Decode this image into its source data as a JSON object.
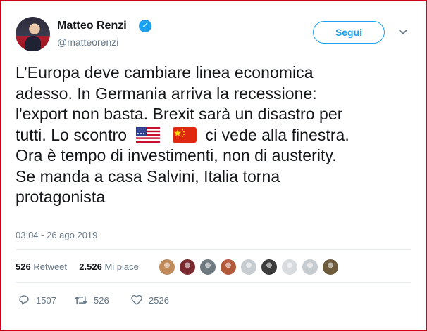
{
  "author": {
    "name": "Matteo Renzi",
    "handle": "@matteorenzi",
    "verified_icon": "verified-badge-icon"
  },
  "header": {
    "follow_label": "Segui",
    "menu_icon": "chevron-down-icon"
  },
  "tweet": {
    "line1": "L’Europa deve cambiare linea economica",
    "line2": "adesso. In Germania arriva la recessione:",
    "line3": "l'export non basta. Brexit sarà un disastro per",
    "line4_start": "tutti. Lo scontro",
    "line4_end": "ci vede alla finestra.",
    "line5": "Ora è tempo di investimenti, non di austerity.",
    "line6": "Se manda a casa Salvini, Italia torna",
    "line7": "protagonista",
    "emoji": [
      "us-flag-icon",
      "china-flag-icon"
    ]
  },
  "timestamp": "03:04 - 26 ago 2019",
  "stats": {
    "retweets_count": "526",
    "retweets_label": "Retweet",
    "likes_count": "2.526",
    "likes_label": "Mi piace"
  },
  "likers": [
    {
      "color": "#c08a5a"
    },
    {
      "color": "#7a2a2e"
    },
    {
      "color": "#6e7a7f"
    },
    {
      "color": "#b2593a"
    },
    {
      "color": "#c7ccd1"
    },
    {
      "color": "#3b3b3b"
    },
    {
      "color": "#d8dcdf"
    },
    {
      "color": "#c7ccd1"
    },
    {
      "color": "#6c5a3a"
    }
  ],
  "actions": {
    "reply_count": "1507",
    "retweet_count": "526",
    "like_count": "2526"
  },
  "colors": {
    "accent": "#1da1f2",
    "text": "#14171a",
    "muted": "#657786"
  }
}
